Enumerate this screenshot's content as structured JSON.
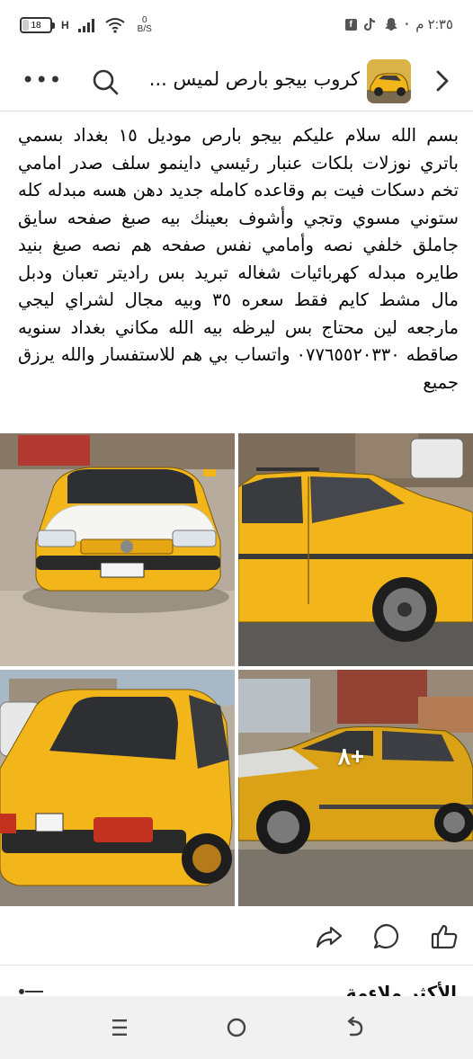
{
  "status_bar": {
    "time": "٢:٣٥ م",
    "battery": "18",
    "network": "H",
    "speed_line1": "0",
    "speed_line2": "B/S",
    "battery_level": 0.18,
    "notification_icons": [
      "facebook-icon",
      "tiktok-icon",
      "snapchat-icon",
      "dot-icon"
    ]
  },
  "header": {
    "title": "كروب بيجو بارص لميس ...",
    "more_icon": "more-dots-icon",
    "search_icon": "search-icon",
    "back_icon": "chevron-right-icon"
  },
  "post": {
    "text": "بسم الله  سلام عليكم بيجو بارص موديل ١٥ بغداد بسمي باتري نوزلات بلكات عنبار رئيسي داينمو سلف صدر امامي تخم دسكات فيت بم وقاعده كامله جديد دهن هسه مبدله كله ستوني مسوي وتجي وأشوف بعينك بيه صبغ صفحه سايق جاملق خلفي نصه وأمامي نفس صفحه هم نصه صبغ بنيد طايره مبدله كهربائيات شغاله تبريد بس راديتر تعبان ودبل مال مشط كايم فقط سعره ٣٥ وبيه مجال لشراي ليجي مارجعه لين محتاج بس ليرظه بيه الله مكاني بغداد سنويه صاقطه ٠٧٧٦٥٥٢٠٣٣٠ واتساب بي هم للاستفسار والله يرزق جميع"
  },
  "photos": {
    "count_more": "٨+",
    "items": [
      "photo-front",
      "photo-side",
      "photo-rear",
      "photo-side-2"
    ]
  },
  "actions": {
    "share_icon": "share-icon",
    "comment_icon": "comment-icon",
    "like_icon": "like-icon"
  },
  "next_section": {
    "title": "الأكثر ملاءمة"
  },
  "nav_bar": {
    "items": [
      "recents-icon",
      "home-icon",
      "back-icon"
    ]
  },
  "colors": {
    "taxi_yellow": "#f2b51a",
    "text": "#050505",
    "divider": "#dcdcdc",
    "nav_bg": "#f1f1f1"
  }
}
